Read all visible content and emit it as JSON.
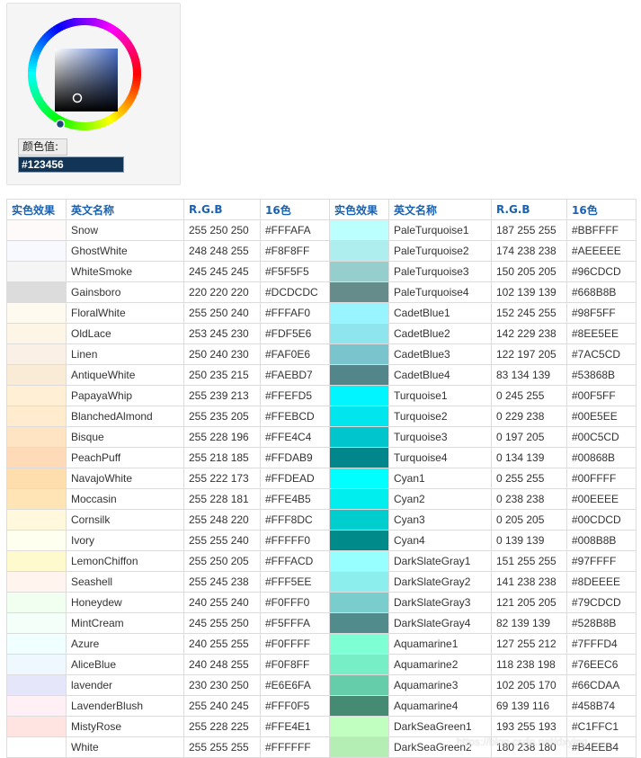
{
  "picker": {
    "label": "颜色值:",
    "value": "#123456"
  },
  "table": {
    "headers": [
      "实色效果",
      "英文名称",
      "R.G.B",
      "16色",
      "实色效果",
      "英文名称",
      "R.G.B",
      "16色"
    ],
    "rows": [
      {
        "left": {
          "name": "Snow",
          "rgb": "255 250 250",
          "hex": "#FFFAFA"
        },
        "right": {
          "name": "PaleTurquoise1",
          "rgb": "187 255 255",
          "hex": "#BBFFFF"
        }
      },
      {
        "left": {
          "name": "GhostWhite",
          "rgb": "248 248 255",
          "hex": "#F8F8FF"
        },
        "right": {
          "name": "PaleTurquoise2",
          "rgb": "174 238 238",
          "hex": "#AEEEEE"
        }
      },
      {
        "left": {
          "name": "WhiteSmoke",
          "rgb": "245 245 245",
          "hex": "#F5F5F5"
        },
        "right": {
          "name": "PaleTurquoise3",
          "rgb": "150 205 205",
          "hex": "#96CDCD"
        }
      },
      {
        "left": {
          "name": "Gainsboro",
          "rgb": "220 220 220",
          "hex": "#DCDCDC"
        },
        "right": {
          "name": "PaleTurquoise4",
          "rgb": "102 139 139",
          "hex": "#668B8B"
        }
      },
      {
        "left": {
          "name": "FloralWhite",
          "rgb": "255 250 240",
          "hex": "#FFFAF0"
        },
        "right": {
          "name": "CadetBlue1",
          "rgb": "152 245 255",
          "hex": "#98F5FF"
        }
      },
      {
        "left": {
          "name": "OldLace",
          "rgb": "253 245 230",
          "hex": "#FDF5E6"
        },
        "right": {
          "name": "CadetBlue2",
          "rgb": "142 229 238",
          "hex": "#8EE5EE"
        }
      },
      {
        "left": {
          "name": "Linen",
          "rgb": "250 240 230",
          "hex": "#FAF0E6"
        },
        "right": {
          "name": "CadetBlue3",
          "rgb": "122 197 205",
          "hex": "#7AC5CD"
        }
      },
      {
        "left": {
          "name": "AntiqueWhite",
          "rgb": "250 235 215",
          "hex": "#FAEBD7"
        },
        "right": {
          "name": "CadetBlue4",
          "rgb": "83 134 139",
          "hex": "#53868B"
        }
      },
      {
        "left": {
          "name": "PapayaWhip",
          "rgb": "255 239 213",
          "hex": "#FFEFD5"
        },
        "right": {
          "name": "Turquoise1",
          "rgb": "0 245 255",
          "hex": "#00F5FF"
        }
      },
      {
        "left": {
          "name": "BlanchedAlmond",
          "rgb": "255 235 205",
          "hex": "#FFEBCD"
        },
        "right": {
          "name": "Turquoise2",
          "rgb": "0 229 238",
          "hex": "#00E5EE"
        }
      },
      {
        "left": {
          "name": "Bisque",
          "rgb": "255 228 196",
          "hex": "#FFE4C4"
        },
        "right": {
          "name": "Turquoise3",
          "rgb": "0 197 205",
          "hex": "#00C5CD"
        }
      },
      {
        "left": {
          "name": "PeachPuff",
          "rgb": "255 218 185",
          "hex": "#FFDAB9"
        },
        "right": {
          "name": "Turquoise4",
          "rgb": "0 134 139",
          "hex": "#00868B"
        }
      },
      {
        "left": {
          "name": "NavajoWhite",
          "rgb": "255 222 173",
          "hex": "#FFDEAD"
        },
        "right": {
          "name": "Cyan1",
          "rgb": "0 255 255",
          "hex": "#00FFFF"
        }
      },
      {
        "left": {
          "name": "Moccasin",
          "rgb": "255 228 181",
          "hex": "#FFE4B5"
        },
        "right": {
          "name": "Cyan2",
          "rgb": "0 238 238",
          "hex": "#00EEEE"
        }
      },
      {
        "left": {
          "name": "Cornsilk",
          "rgb": "255 248 220",
          "hex": "#FFF8DC"
        },
        "right": {
          "name": "Cyan3",
          "rgb": "0 205 205",
          "hex": "#00CDCD"
        }
      },
      {
        "left": {
          "name": "Ivory",
          "rgb": "255 255 240",
          "hex": "#FFFFF0"
        },
        "right": {
          "name": "Cyan4",
          "rgb": "0 139 139",
          "hex": "#008B8B"
        }
      },
      {
        "left": {
          "name": "LemonChiffon",
          "rgb": "255 250 205",
          "hex": "#FFFACD"
        },
        "right": {
          "name": "DarkSlateGray1",
          "rgb": "151 255 255",
          "hex": "#97FFFF"
        }
      },
      {
        "left": {
          "name": "Seashell",
          "rgb": "255 245 238",
          "hex": "#FFF5EE"
        },
        "right": {
          "name": "DarkSlateGray2",
          "rgb": "141 238 238",
          "hex": "#8DEEEE"
        }
      },
      {
        "left": {
          "name": "Honeydew",
          "rgb": "240 255 240",
          "hex": "#F0FFF0"
        },
        "right": {
          "name": "DarkSlateGray3",
          "rgb": "121 205 205",
          "hex": "#79CDCD"
        }
      },
      {
        "left": {
          "name": "MintCream",
          "rgb": "245 255 250",
          "hex": "#F5FFFA"
        },
        "right": {
          "name": "DarkSlateGray4",
          "rgb": "82 139 139",
          "hex": "#528B8B"
        }
      },
      {
        "left": {
          "name": "Azure",
          "rgb": "240 255 255",
          "hex": "#F0FFFF"
        },
        "right": {
          "name": "Aquamarine1",
          "rgb": "127 255 212",
          "hex": "#7FFFD4"
        }
      },
      {
        "left": {
          "name": "AliceBlue",
          "rgb": "240 248 255",
          "hex": "#F0F8FF"
        },
        "right": {
          "name": "Aquamarine2",
          "rgb": "118 238 198",
          "hex": "#76EEC6"
        }
      },
      {
        "left": {
          "name": "lavender",
          "rgb": "230 230 250",
          "hex": "#E6E6FA"
        },
        "right": {
          "name": "Aquamarine3",
          "rgb": "102 205 170",
          "hex": "#66CDAA"
        }
      },
      {
        "left": {
          "name": "LavenderBlush",
          "rgb": "255 240 245",
          "hex": "#FFF0F5"
        },
        "right": {
          "name": "Aquamarine4",
          "rgb": "69 139 116",
          "hex": "#458B74"
        }
      },
      {
        "left": {
          "name": "MistyRose",
          "rgb": "255 228 225",
          "hex": "#FFE4E1"
        },
        "right": {
          "name": "DarkSeaGreen1",
          "rgb": "193 255 193",
          "hex": "#C1FFC1"
        }
      },
      {
        "left": {
          "name": "White",
          "rgb": "255 255 255",
          "hex": "#FFFFFF"
        },
        "right": {
          "name": "DarkSeaGreen2",
          "rgb": "180 238 180",
          "hex": "#B4EEB4"
        }
      }
    ]
  },
  "watermark": "https://blog.csdn.net/dxying"
}
